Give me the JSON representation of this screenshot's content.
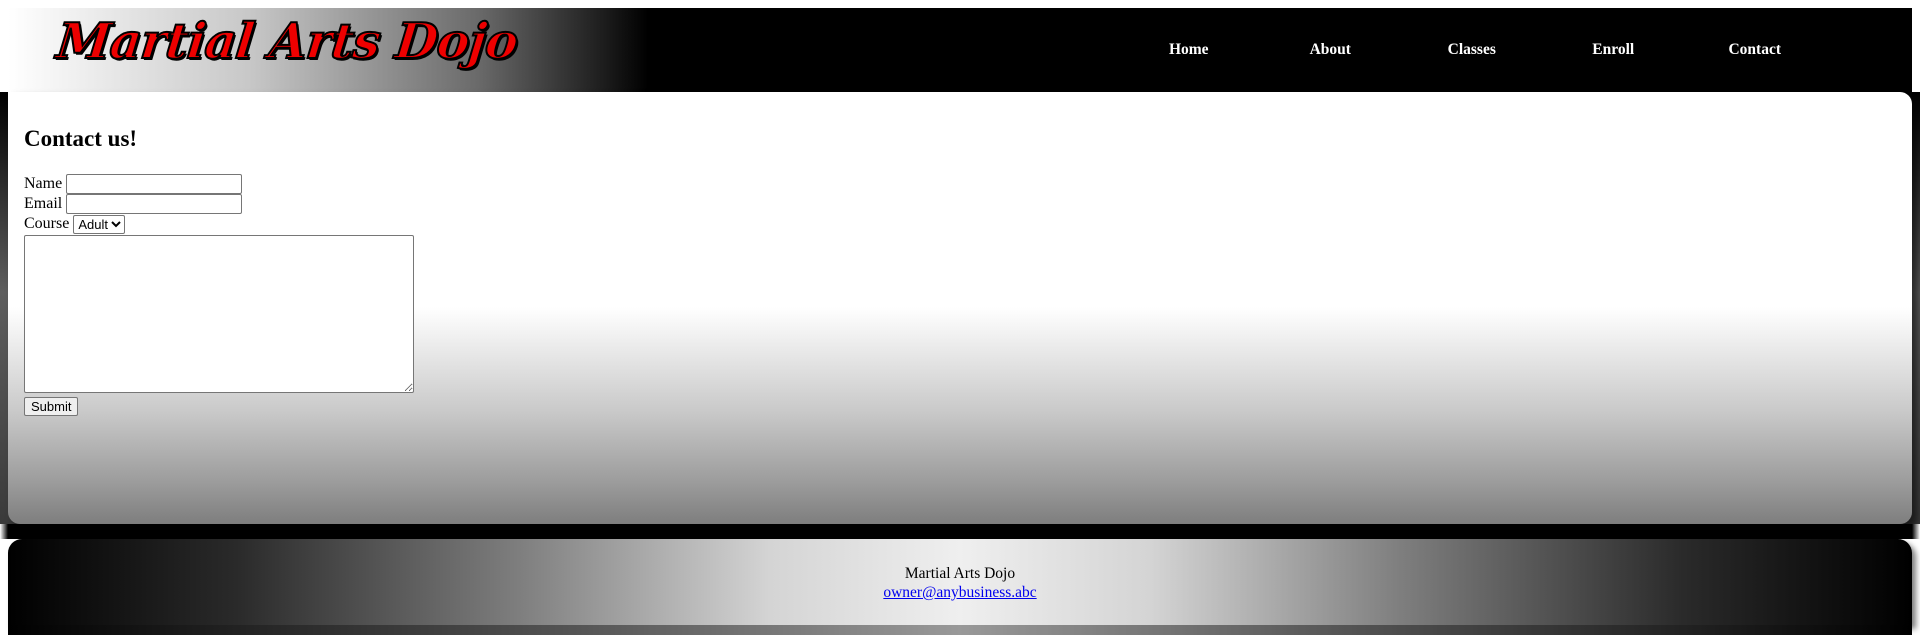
{
  "header": {
    "logo_text": "Martial Arts Dojo",
    "nav": [
      {
        "label": "Home"
      },
      {
        "label": "About"
      },
      {
        "label": "Classes"
      },
      {
        "label": "Enroll"
      },
      {
        "label": "Contact"
      }
    ]
  },
  "main": {
    "heading": "Contact us!",
    "form": {
      "name_label": "Name",
      "name_value": "",
      "email_label": "Email",
      "email_value": "",
      "course_label": "Course",
      "course_selected": "Adult",
      "message_value": "",
      "submit_label": "Submit"
    }
  },
  "footer": {
    "name": "Martial Arts Dojo",
    "email": "owner@anybusiness.abc"
  },
  "colors": {
    "logo_fill": "#ee0000",
    "nav_text": "#ffffff",
    "link": "#0000ee"
  }
}
